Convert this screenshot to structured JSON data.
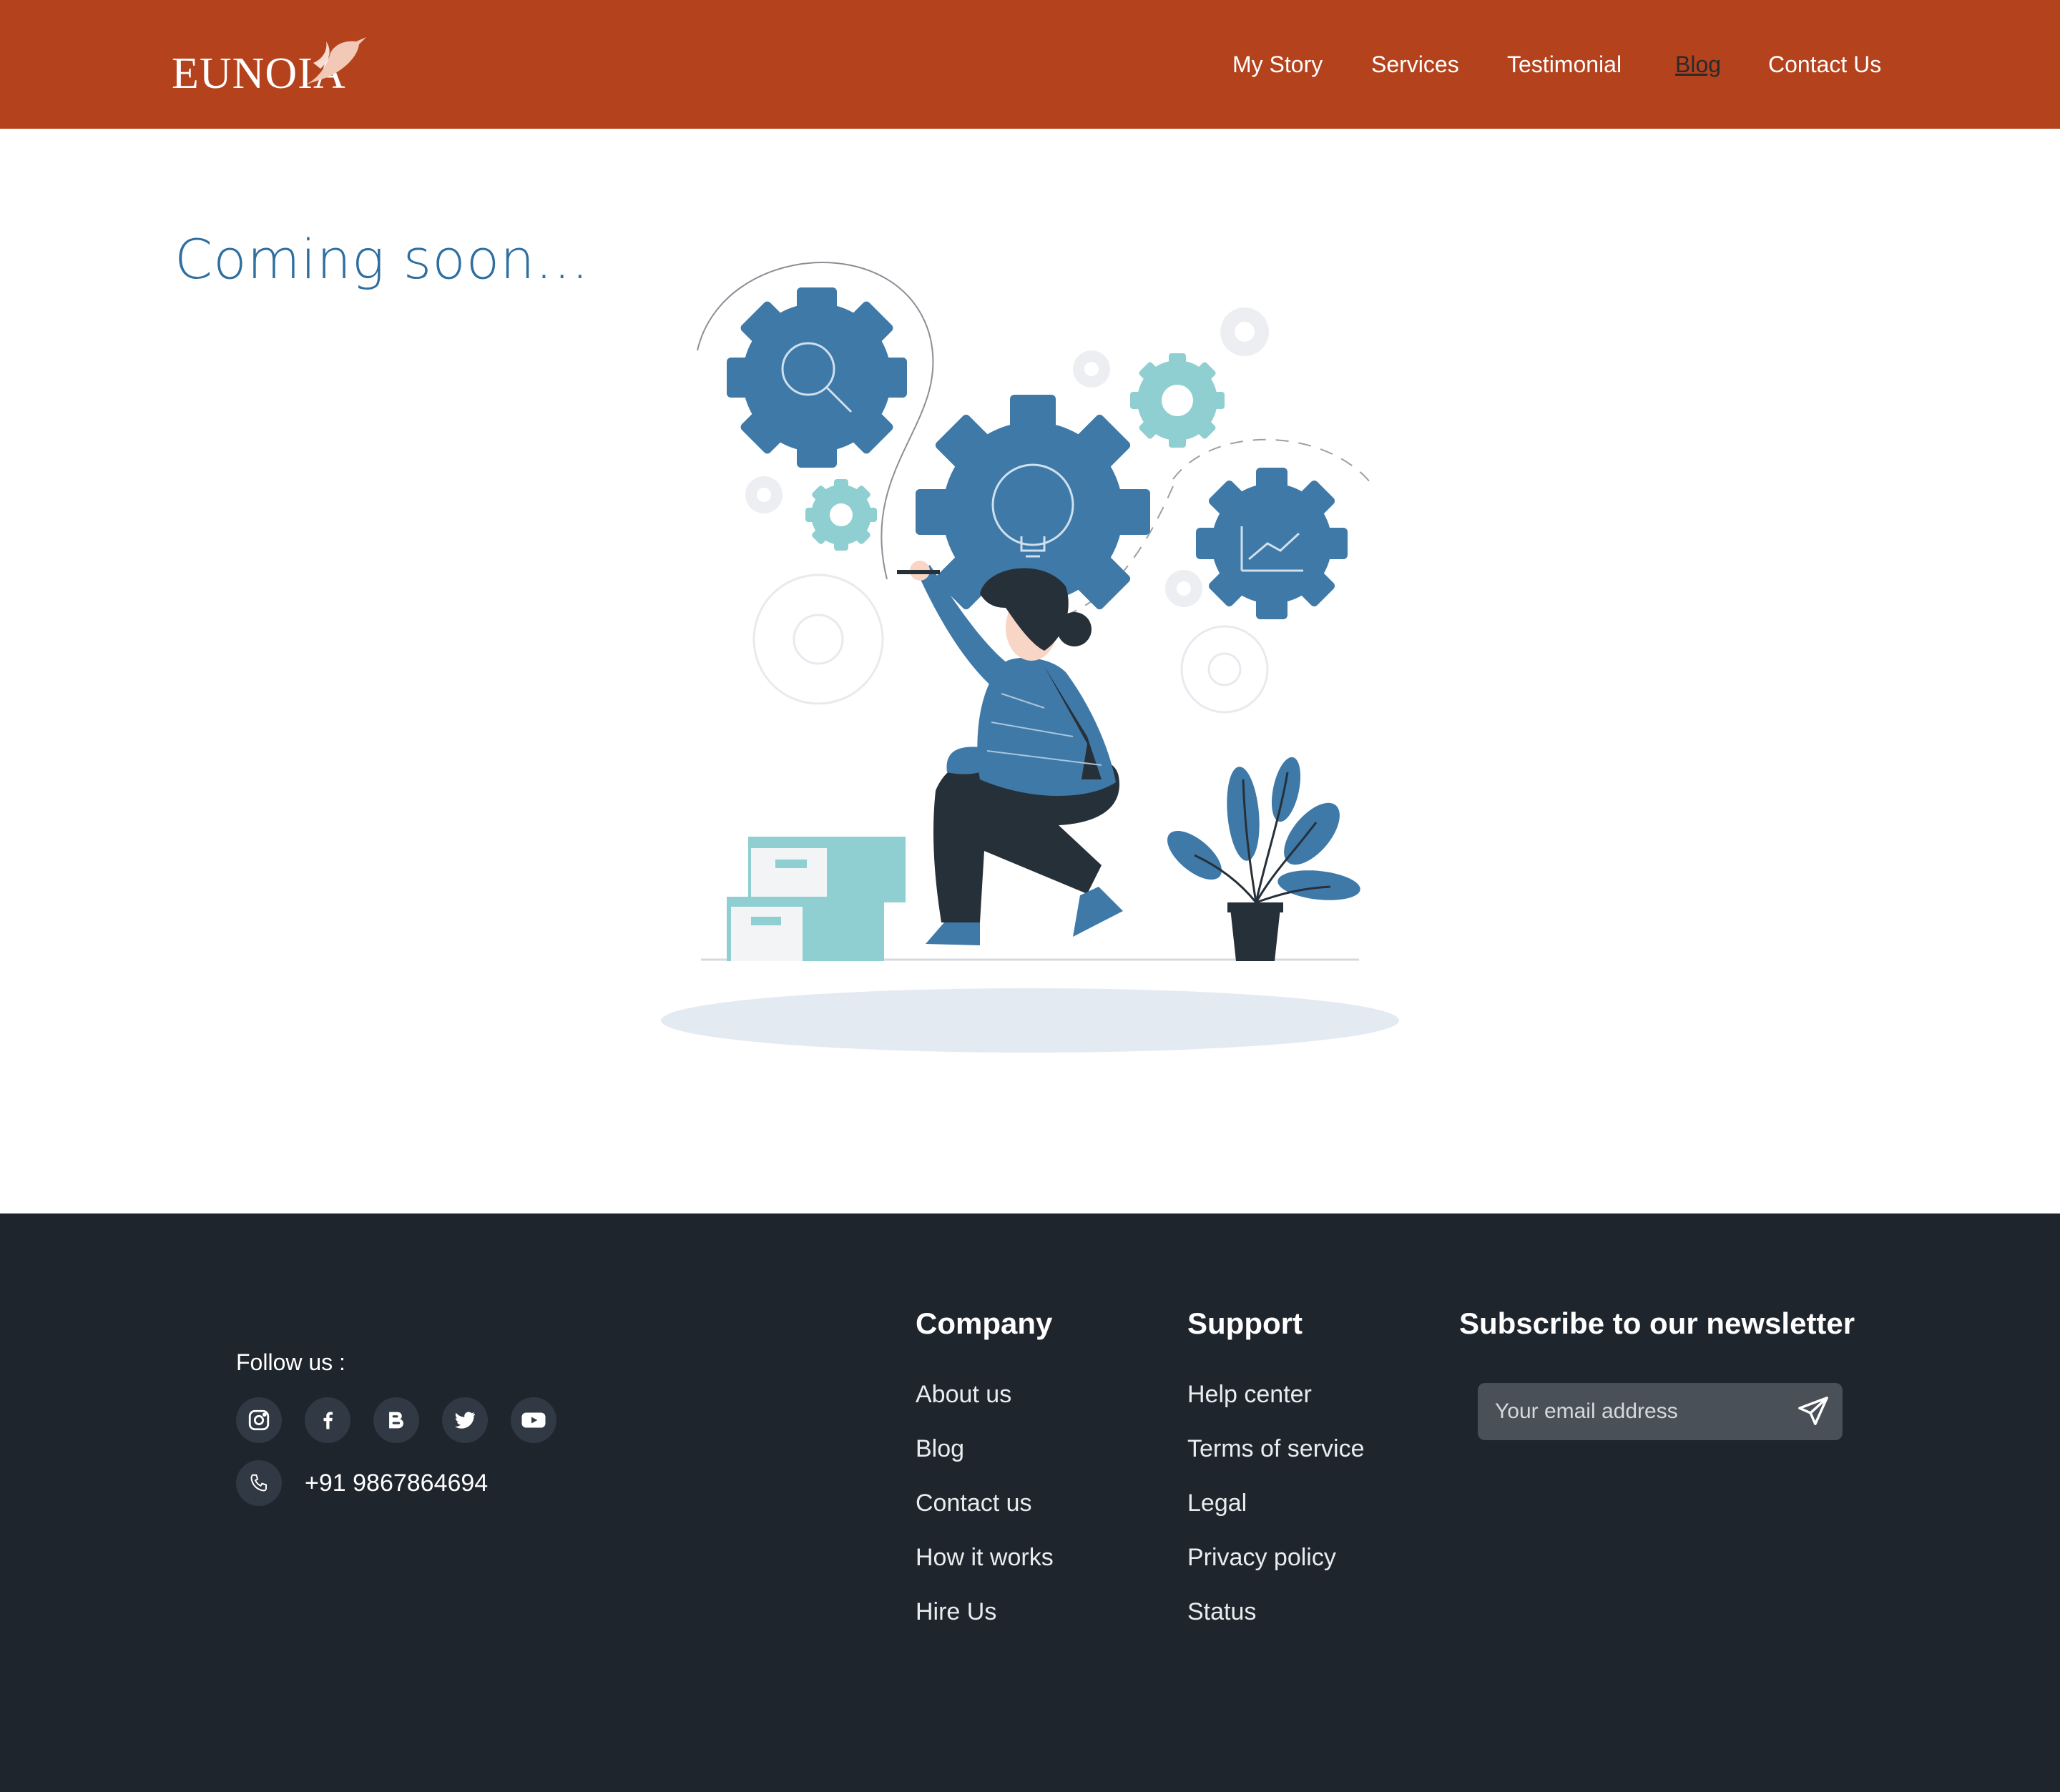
{
  "header": {
    "logo_text": "EUNOIA",
    "nav": [
      {
        "label": "My Story"
      },
      {
        "label": "Services"
      },
      {
        "label": "Testimonial"
      },
      {
        "label": "Blog"
      },
      {
        "label": "Contact Us"
      }
    ]
  },
  "main": {
    "title": "Coming soon..."
  },
  "footer": {
    "follow_label": "Follow us :",
    "social_icons": [
      "instagram-icon",
      "facebook-icon",
      "blogger-icon",
      "twitter-icon",
      "youtube-icon"
    ],
    "phone": "+91 9867864694",
    "company": {
      "heading": "Company",
      "links": [
        "About us",
        "Blog",
        "Contact us",
        "How it works",
        "Hire Us"
      ]
    },
    "support": {
      "heading": "Support",
      "links": [
        "Help center",
        "Terms of service",
        "Legal",
        "Privacy policy",
        "Status"
      ]
    },
    "newsletter": {
      "heading": "Subscribe to our newsletter",
      "placeholder": "Your email address"
    }
  },
  "colors": {
    "header_bg": "#B3421D",
    "footer_bg": "#1F252C",
    "accent_blue": "#3F79A8",
    "accent_teal": "#8FCFD1"
  }
}
